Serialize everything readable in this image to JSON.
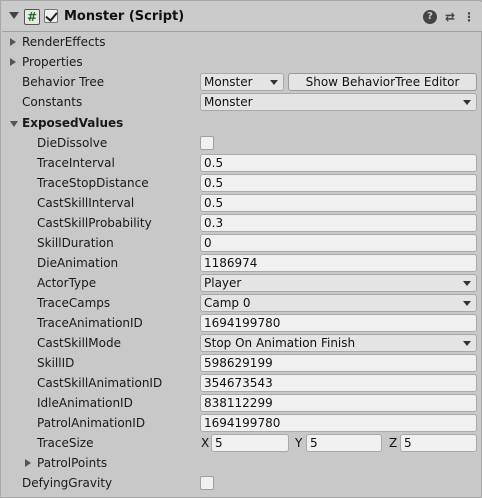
{
  "header": {
    "script_icon": "#",
    "title": "Monster (Script)",
    "help_icon": "?",
    "preset_icon": "⇄",
    "menu_icon": "⋮"
  },
  "sections": {
    "render_effects": "RenderEffects",
    "properties": "Properties",
    "exposed_values": "ExposedValues",
    "patrol_points": "PatrolPoints"
  },
  "behavior_tree": {
    "label": "Behavior Tree",
    "value": "Monster",
    "editor_button": "Show BehaviorTree Editor"
  },
  "constants": {
    "label": "Constants",
    "value": "Monster"
  },
  "fields": {
    "die_dissolve": {
      "label": "DieDissolve",
      "checked": false
    },
    "trace_interval": {
      "label": "TraceInterval",
      "value": "0.5"
    },
    "trace_stop_distance": {
      "label": "TraceStopDistance",
      "value": "0.5"
    },
    "cast_skill_interval": {
      "label": "CastSkillInterval",
      "value": "0.5"
    },
    "cast_skill_probability": {
      "label": "CastSkillProbability",
      "value": "0.3"
    },
    "skill_duration": {
      "label": "SkillDuration",
      "value": "0"
    },
    "die_animation": {
      "label": "DieAnimation",
      "value": "1186974"
    },
    "actor_type": {
      "label": "ActorType",
      "value": "Player"
    },
    "trace_camps": {
      "label": "TraceCamps",
      "value": "Camp 0"
    },
    "trace_animation_id": {
      "label": "TraceAnimationID",
      "value": "1694199780"
    },
    "cast_skill_mode": {
      "label": "CastSkillMode",
      "value": "Stop On Animation Finish"
    },
    "skill_id": {
      "label": "SkillID",
      "value": "598629199"
    },
    "cast_skill_animation_id": {
      "label": "CastSkillAnimationID",
      "value": "354673543"
    },
    "idle_animation_id": {
      "label": "IdleAnimationID",
      "value": "838112299"
    },
    "patrol_animation_id": {
      "label": "PatrolAnimationID",
      "value": "1694199780"
    },
    "trace_size": {
      "label": "TraceSize",
      "x_label": "X",
      "x": "5",
      "y_label": "Y",
      "y": "5",
      "z_label": "Z",
      "z": "5"
    },
    "defying_gravity": {
      "label": "DefyingGravity",
      "checked": false
    }
  }
}
